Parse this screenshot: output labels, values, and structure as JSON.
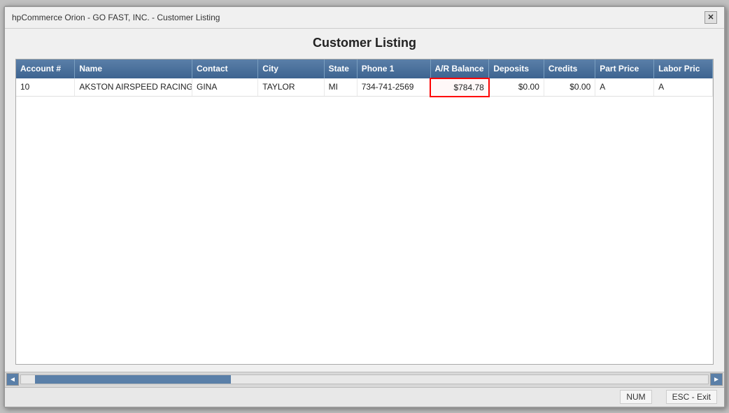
{
  "window": {
    "title": "hpCommerce Orion - GO FAST, INC. - Customer Listing",
    "close_btn": "✕"
  },
  "page": {
    "title": "Customer Listing"
  },
  "table": {
    "columns": [
      {
        "key": "account",
        "label": "Account #",
        "class": "col-account"
      },
      {
        "key": "name",
        "label": "Name",
        "class": "col-name"
      },
      {
        "key": "contact",
        "label": "Contact",
        "class": "col-contact"
      },
      {
        "key": "city",
        "label": "City",
        "class": "col-city"
      },
      {
        "key": "state",
        "label": "State",
        "class": "col-state"
      },
      {
        "key": "phone",
        "label": "Phone 1",
        "class": "col-phone"
      },
      {
        "key": "arbalance",
        "label": "A/R Balance",
        "class": "col-arbalance"
      },
      {
        "key": "deposits",
        "label": "Deposits",
        "class": "col-deposits"
      },
      {
        "key": "credits",
        "label": "Credits",
        "class": "col-credits"
      },
      {
        "key": "partprice",
        "label": "Part Price",
        "class": "col-partprice"
      },
      {
        "key": "laborprice",
        "label": "Labor Pric",
        "class": "col-laborprice"
      }
    ],
    "rows": [
      {
        "account": "10",
        "name": "AKSTON AIRSPEED RACING",
        "contact": "GINA",
        "city": "TAYLOR",
        "state": "MI",
        "phone": "734-741-2569",
        "arbalance": "$784.78",
        "deposits": "$0.00",
        "credits": "$0.00",
        "partprice": "A",
        "laborprice": "A"
      }
    ]
  },
  "status_bar": {
    "num_label": "NUM",
    "esc_label": "ESC - Exit"
  },
  "scroll": {
    "left_arrow": "◄",
    "right_arrow": "►"
  }
}
